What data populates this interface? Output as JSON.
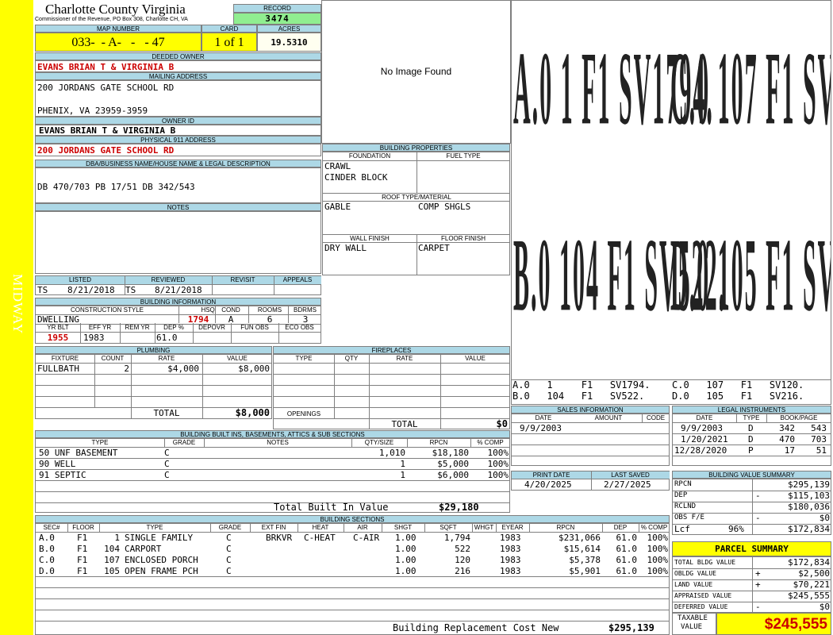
{
  "side_label": "MIDWAY",
  "header": {
    "county": "Charlotte County Virginia",
    "commissioner": "Commissioner of the Revenue, PO Box 308, Charlotte CH, VA",
    "record_label": "RECORD",
    "record": "3474"
  },
  "map": {
    "map_label": "MAP NUMBER",
    "map_number": "033-  - A-   -   - 47",
    "card_label": "CARD",
    "card": "1 of 1",
    "acres_label": "ACRES",
    "acres": "19.5310"
  },
  "owner": {
    "deeded_label": "DEEDED OWNER",
    "deeded": "EVANS BRIAN T & VIRGINIA B",
    "mailing_label": "MAILING ADDRESS",
    "mailing_1": "200 JORDANS GATE SCHOOL RD",
    "mailing_2": "PHENIX, VA 23959-3959",
    "owner_id_label": "OWNER ID",
    "owner_id": "EVANS BRIAN T & VIRGINIA B",
    "address_label": "PHYSICAL 911 ADDRESS",
    "address": "200 JORDANS GATE SCHOOL RD"
  },
  "legal": {
    "label": "DBA/BUSINESS NAME/HOUSE NAME & LEGAL DESCRIPTION",
    "text": "DB 470/703 PB 17/51 DB 342/543"
  },
  "notes": {
    "label": "NOTES"
  },
  "image": {
    "text": "No Image Found"
  },
  "building_props": {
    "label": "BUILDING PROPERTIES",
    "foundation_label": "FOUNDATION",
    "fuel_label": "FUEL TYPE",
    "foundation_1": "CRAWL",
    "foundation_2": "CINDER BLOCK",
    "roof_label": "ROOF TYPE/MATERIAL",
    "roof_type": "GABLE",
    "roof_material": "COMP SHGLS",
    "wall_label": "WALL FINISH",
    "floor_label": "FLOOR FINISH",
    "wall": "DRY WALL",
    "floor": "CARPET"
  },
  "listing": {
    "listed_label": "LISTED",
    "reviewed_label": "REVIEWED",
    "revisit_label": "REVISIT",
    "appeals_label": "APPEALS",
    "listed_by": "TS",
    "listed_date": "8/21/2018",
    "reviewed_by": "TS",
    "reviewed_date": "8/21/2018"
  },
  "building_info": {
    "label": "BUILDING INFORMATION",
    "style_label": "CONSTRUCTION STYLE",
    "hsqft_label": "HSQFT",
    "cond_label": "COND",
    "rooms_label": "ROOMS",
    "bdrms_label": "BDRMS",
    "style": "DWELLING",
    "hsqft": "1794",
    "cond": "A",
    "rooms": "6",
    "bdrms": "3",
    "yrblt_label": "YR BLT",
    "effyr_label": "EFF YR",
    "remyr_label": "REM YR",
    "dep_label": "DEP %",
    "depovr_label": "DEPOVR",
    "funobs_label": "FUN OBS",
    "ecoobs_label": "ECO OBS",
    "yrblt": "1955",
    "effyr": "1983",
    "dep": "61.0"
  },
  "plumbing": {
    "label": "PLUMBING",
    "columns": [
      "FIXTURE",
      "COUNT",
      "RATE",
      "VALUE"
    ],
    "fixture": "FULLBATH",
    "count": "2",
    "rate": "$4,000",
    "value": "$8,000",
    "total_label": "TOTAL",
    "total": "$8,000"
  },
  "fireplaces": {
    "label": "FIREPLACES",
    "columns": [
      "TYPE",
      "QTY",
      "RATE",
      "VALUE"
    ],
    "openings_label": "OPENINGS",
    "total_label": "TOTAL",
    "total": "$0"
  },
  "sketch": {
    "labels": [
      {
        "id": "A.0",
        "code": "1",
        "floor": "F1",
        "sv": "SV1794."
      },
      {
        "id": "B.0",
        "code": "104",
        "floor": "F1",
        "sv": "SV522."
      },
      {
        "id": "C.0",
        "code": "107",
        "floor": "F1",
        "sv": "SV120."
      },
      {
        "id": "D.0",
        "code": "105",
        "floor": "F1",
        "sv": "SV216."
      }
    ]
  },
  "sales": {
    "label": "SALES INFORMATION",
    "columns": [
      "DATE",
      "AMOUNT",
      "CODE"
    ],
    "date": "9/9/2003"
  },
  "legal_instruments": {
    "label": "LEGAL INSTRUMENTS",
    "columns": [
      "DATE",
      "TYPE",
      "BOOK/PAGE"
    ],
    "rows": [
      {
        "date": "9/9/2003",
        "type": "D",
        "book": "342",
        "page": "543"
      },
      {
        "date": "1/20/2021",
        "type": "D",
        "book": "470",
        "page": "703"
      },
      {
        "date": "12/28/2020",
        "type": "P",
        "book": "17",
        "page": "51"
      }
    ]
  },
  "print": {
    "print_label": "PRINT DATE",
    "print_date": "4/20/2025",
    "saved_label": "LAST SAVED",
    "saved_date": "2/27/2025"
  },
  "builtins": {
    "label": "BUILDING BUILT INS, BASEMENTS, ATTICS & SUB SECTIONS",
    "columns": [
      "TYPE",
      "GRADE",
      "NOTES",
      "QTY/SIZE",
      "RPCN",
      "% COMP"
    ],
    "rows": [
      {
        "type": "50 UNF BASEMENT",
        "grade": "C",
        "qty": "1,010",
        "rpcn": "$18,180",
        "comp": "100%"
      },
      {
        "type": "90 WELL",
        "grade": "C",
        "qty": "1",
        "rpcn": "$5,000",
        "comp": "100%"
      },
      {
        "type": "91 SEPTIC",
        "grade": "C",
        "qty": "1",
        "rpcn": "$6,000",
        "comp": "100%"
      }
    ],
    "total_label": "Total Built In Value",
    "total": "$29,180"
  },
  "sections": {
    "label": "BUILDING SECTIONS",
    "columns": [
      "SEC#",
      "FLOOR",
      "TYPE",
      "GRADE",
      "EXT FIN",
      "HEAT",
      "AIR",
      "SHGT",
      "SQFT",
      "WHGT",
      "EYEAR",
      "RPCN",
      "DEP",
      "% COMP"
    ],
    "rows": [
      {
        "sec": "A.0",
        "floor": "F1",
        "code": "1",
        "type": "SINGLE FAMILY",
        "grade": "C",
        "ext": "BRKVR",
        "heat": "C-HEAT",
        "air": "C-AIR",
        "shgt": "1.00",
        "sqft": "1,794",
        "eyear": "1983",
        "rpcn": "$231,066",
        "dep": "61.0",
        "comp": "100%"
      },
      {
        "sec": "B.0",
        "floor": "F1",
        "code": "104",
        "type": "CARPORT",
        "grade": "C",
        "ext": "",
        "heat": "",
        "air": "",
        "shgt": "1.00",
        "sqft": "522",
        "eyear": "1983",
        "rpcn": "$15,614",
        "dep": "61.0",
        "comp": "100%"
      },
      {
        "sec": "C.0",
        "floor": "F1",
        "code": "107",
        "type": "ENCLOSED PORCH",
        "grade": "C",
        "ext": "",
        "heat": "",
        "air": "",
        "shgt": "1.00",
        "sqft": "120",
        "eyear": "1983",
        "rpcn": "$5,378",
        "dep": "61.0",
        "comp": "100%"
      },
      {
        "sec": "D.0",
        "floor": "F1",
        "code": "105",
        "type": "OPEN FRAME PCH",
        "grade": "C",
        "ext": "",
        "heat": "",
        "air": "",
        "shgt": "1.00",
        "sqft": "216",
        "eyear": "1983",
        "rpcn": "$5,901",
        "dep": "61.0",
        "comp": "100%"
      }
    ],
    "replacement_label": "Building Replacement Cost New",
    "replacement": "$295,139"
  },
  "value_summary": {
    "label": "BUILDING VALUE SUMMARY",
    "rpcn_label": "RPCN",
    "rpcn": "$295,139",
    "dep_label": "DEP",
    "dep_sign": "-",
    "dep": "$115,103",
    "rclnd_label": "RCLND",
    "rclnd": "$180,036",
    "obs_label": "OBS F/E",
    "obs_sign": "-",
    "obs": "$0",
    "lcf_label": "Lcf",
    "lcf_pct": "96%",
    "lcf": "$172,834"
  },
  "parcel": {
    "label": "PARCEL SUMMARY",
    "bldg_label": "TOTAL BLDG VALUE",
    "bldg": "$172,834",
    "obldg_label": "OBLDG VALUE",
    "obldg_sign": "+",
    "obldg": "$2,500",
    "land_label": "LAND VALUE",
    "land_sign": "+",
    "land": "$70,221",
    "appraised_label": "APPRAISED VALUE",
    "appraised": "$245,555",
    "deferred_label": "DEFERRED VALUE",
    "deferred_sign": "-",
    "deferred": "$0",
    "taxable_label_1": "TAXABLE",
    "taxable_label_2": "VALUE",
    "taxable": "$245,555"
  }
}
